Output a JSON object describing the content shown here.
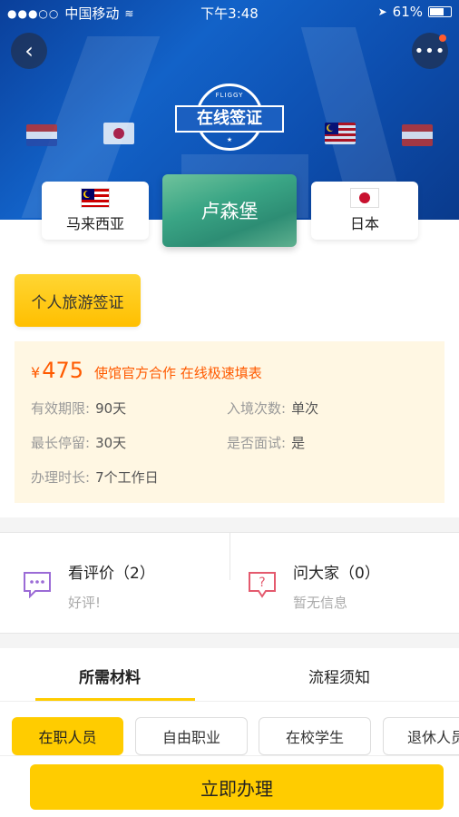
{
  "status_bar": {
    "carrier": "中国移动",
    "time": "下午3:48",
    "battery": "61%"
  },
  "hero": {
    "badge_text": "在线签证",
    "badge_brand": "FLIGGY",
    "badge_stars": "★"
  },
  "countries": {
    "left": "马来西亚",
    "center": "卢森堡",
    "right": "日本"
  },
  "visa": {
    "type_label": "个人旅游签证",
    "currency": "¥",
    "price": "475",
    "tagline": "使馆官方合作 在线极速填表",
    "fields": [
      {
        "key": "有效期限:",
        "value": "90天"
      },
      {
        "key": "入境次数:",
        "value": "单次"
      },
      {
        "key": "最长停留:",
        "value": "30天"
      },
      {
        "key": "是否面试:",
        "value": "是"
      },
      {
        "key": "办理时长:",
        "value": "7个工作日"
      }
    ]
  },
  "reviews": {
    "title": "看评价（2）",
    "sub": "好评!"
  },
  "qa": {
    "title": "问大家（0）",
    "sub": "暂无信息"
  },
  "tabs": {
    "materials": "所需材料",
    "process": "流程须知"
  },
  "chips": [
    "在职人员",
    "自由职业",
    "在校学生",
    "退休人员"
  ],
  "cta": {
    "label": "立即办理"
  },
  "colors": {
    "accent": "#ffcc00",
    "price": "#ff5a00",
    "hero": "#1262c8"
  }
}
